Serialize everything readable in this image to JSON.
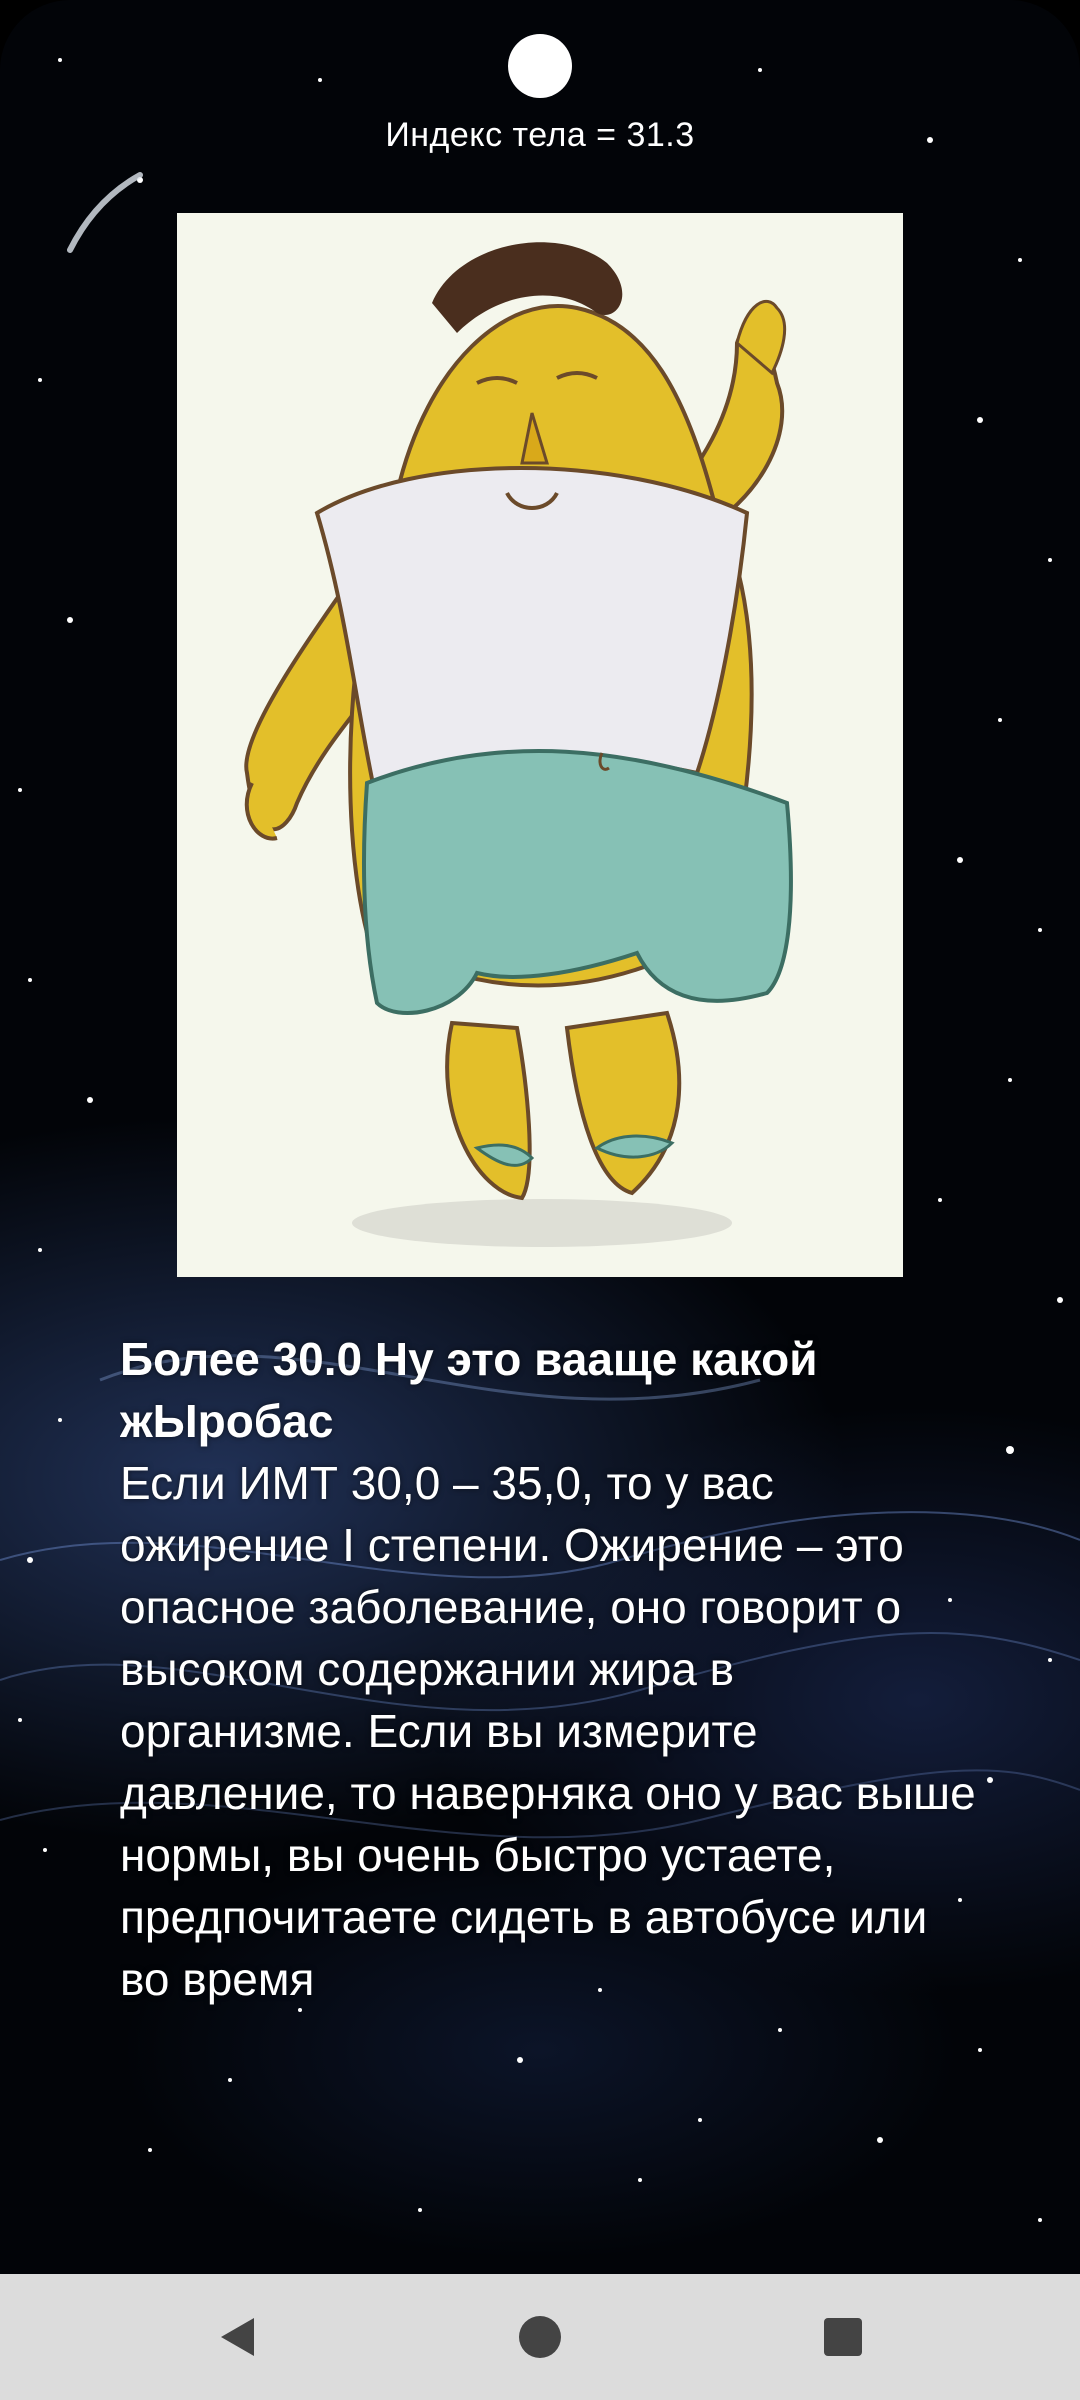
{
  "header": {
    "bmi_label": "Индекс тела = 31.3"
  },
  "illustration": {
    "icon": "overweight-man-illustration"
  },
  "content": {
    "heading": " Более 30.0 Ну это вааще какой жЫробас",
    "description": " Если ИМТ 30,0 – 35,0, то у вас ожирение I степени. Ожирение – это опасное заболевание, оно говорит о высоком содержании жира в организме. Если вы измерите давление, то наверняка оно у вас выше нормы, вы очень быстро устаете, предпочитаете сидеть в автобусе или во время"
  },
  "navigation": {
    "back_icon": "back-triangle-icon",
    "home_icon": "home-circle-icon",
    "recents_icon": "recents-square-icon"
  },
  "colors": {
    "background": "#020408",
    "text": "#ffffff",
    "nav_bar": "#dcdcdc",
    "skin": "#e3bf2a",
    "shorts": "#86c1b5"
  }
}
